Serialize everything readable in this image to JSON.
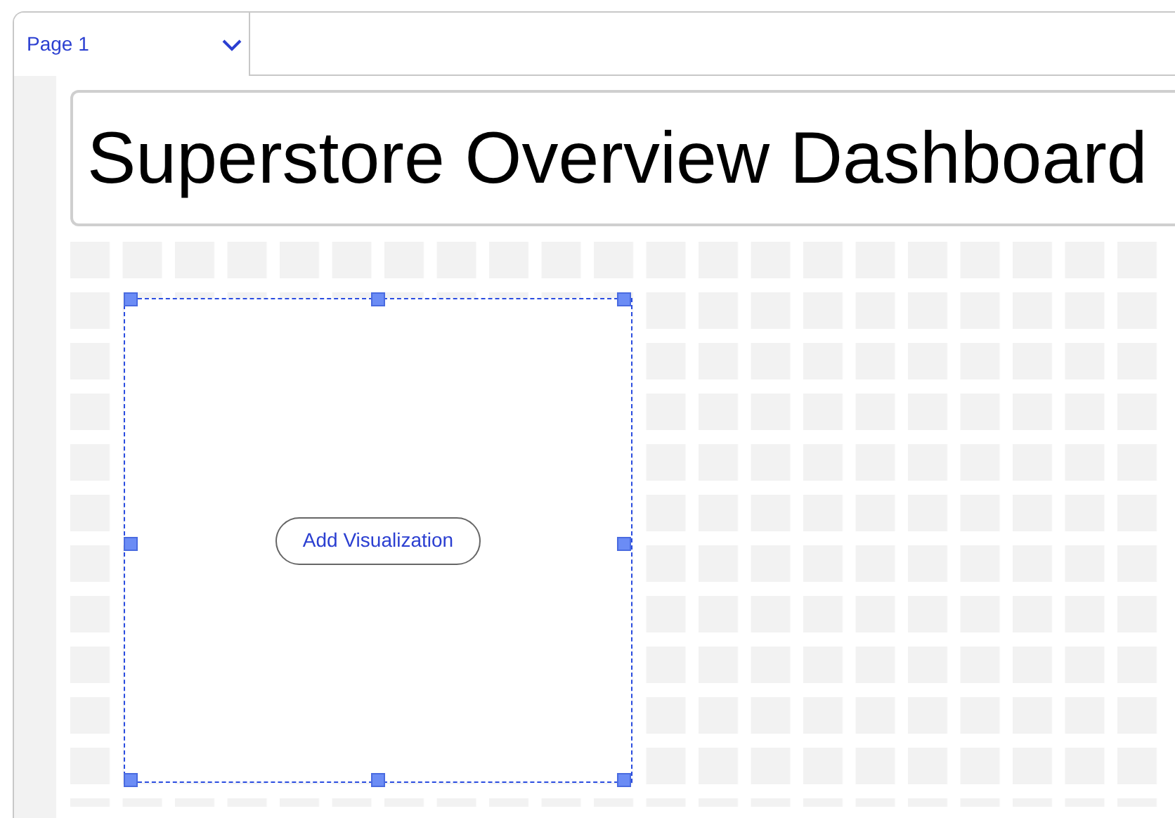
{
  "tabs": [
    {
      "label": "Page 1",
      "selected": true
    }
  ],
  "title": "Superstore Overview Dashboard",
  "visual": {
    "button": "Add Visualization",
    "selected": true
  }
}
